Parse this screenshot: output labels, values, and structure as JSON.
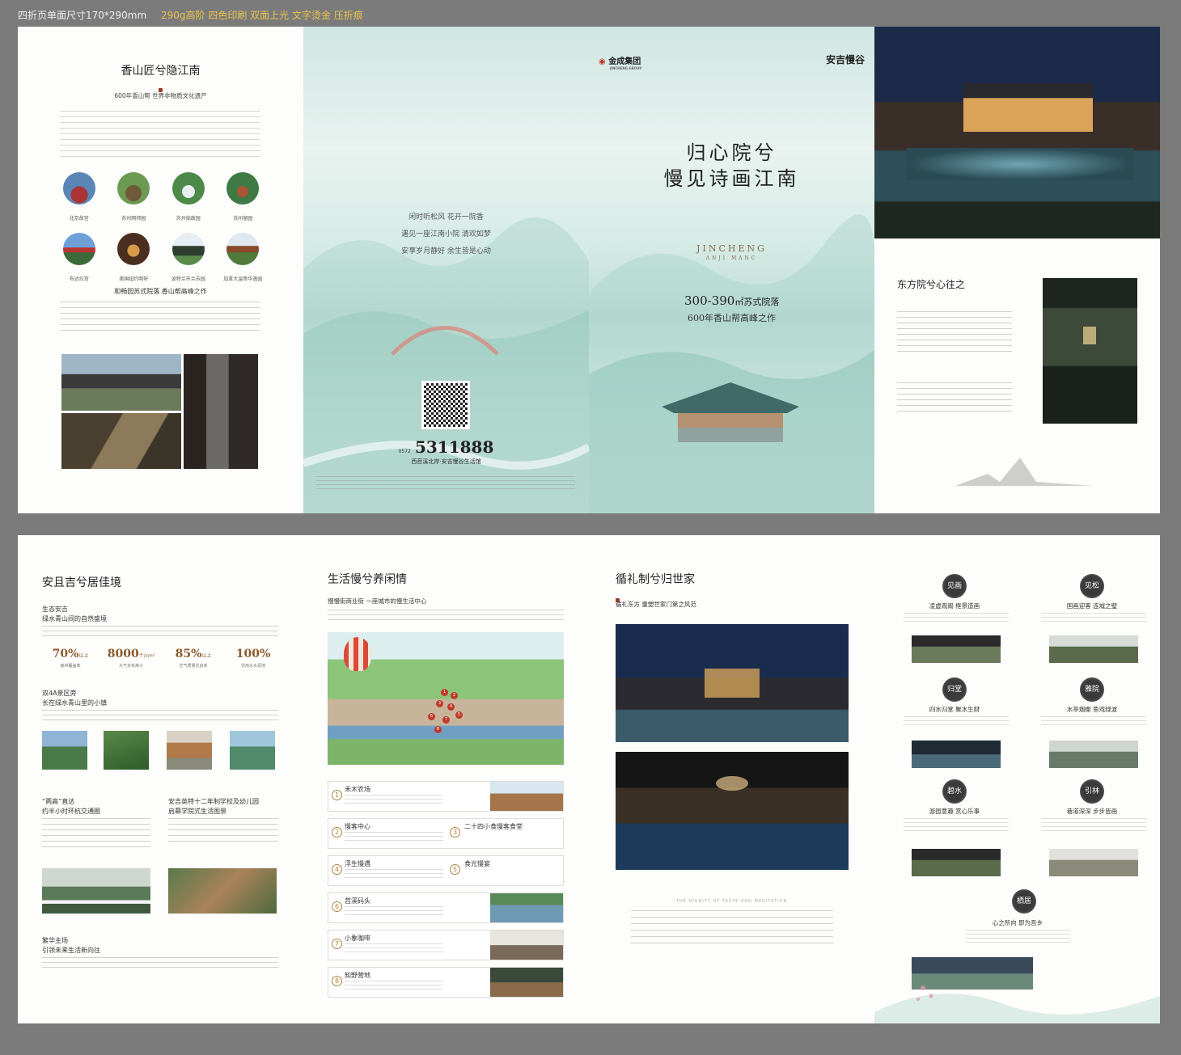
{
  "spec": {
    "text": "四折页单面尺寸170*290mm",
    "gold": "290g高阶 四色印刷 双面上光 文字烫金 压折痕"
  },
  "p1": {
    "title": "香山匠兮隐江南",
    "subtitle": "600年香山帮  世界非物质文化遗产",
    "sites": [
      "北京故宫",
      "苏州网师园",
      "苏州拙政园",
      "苏州留园",
      "布达拉宫",
      "美国纽约明轩",
      "波特兰市兰苏园",
      "加拿大温哥华逸园"
    ],
    "sub2": "和畅园苏式院落  香山帮高峰之作"
  },
  "p2": {
    "poem": [
      "闲时听松风  花开一院香",
      "遇见一座江南小院  清欢如梦",
      "安享岁月静好  余生皆是心动"
    ],
    "tel_prefix": "0572",
    "tel": "5311888",
    "address": "西苕溪北岸·安吉慢谷生活馆"
  },
  "p3": {
    "brand": "金成集团",
    "brand_en": "JINCHENG GROUP",
    "project": "安吉慢谷",
    "headline1": "归心院兮",
    "headline2": "慢见诗画江南",
    "en1": "JINCHENG",
    "en2": "ANJI MANC",
    "area": "300-390",
    "area_unit": "㎡苏式院落",
    "tagline": "600年香山帮高峰之作"
  },
  "p4": {
    "title": "东方院兮心往之"
  },
  "b1": {
    "title": "安且吉兮居佳境",
    "s1a": "生态安吉",
    "s1b": "绿水青山间的自然盛境",
    "stats": [
      {
        "v": "70%",
        "u": "以上",
        "d": "森林覆盖率"
      },
      {
        "v": "8000",
        "u": "个/cm³",
        "d": "大气负氧离子"
      },
      {
        "v": "85%",
        "u": "以上",
        "d": "空气质量优良率"
      },
      {
        "v": "100%",
        "u": "",
        "d": "饮用水水源地"
      }
    ],
    "s2a": "双4A景区旁",
    "s2b": "长在绿水青山里的小镇",
    "s3a": "“两高”直达",
    "s3b": "约半小时环杭交通圈",
    "s4a": "安吉英特十二年制学校及幼儿园",
    "s4b": "启幕学院式生活图景",
    "s5a": "繁华主场",
    "s5b": "引领未来生活新向往"
  },
  "b2": {
    "title": "生活慢兮养闲情",
    "sub": "慢慢街商业街  一座城市的慢生活中心",
    "items": [
      {
        "n": "1",
        "h": "禾木农场",
        "h2": ""
      },
      {
        "n": "2",
        "h": "慢客中心",
        "h2": "二十四小食慢客食堂"
      },
      {
        "n": "4",
        "h": "浮生慢遇",
        "h2": "食光慢宴"
      },
      {
        "n": "6",
        "h": "苕溪码头",
        "h2": ""
      },
      {
        "n": "7",
        "h": "小象咖啡",
        "h2": ""
      },
      {
        "n": "8",
        "h": "知野营地",
        "h2": ""
      }
    ],
    "pins": [
      "1",
      "2",
      "3",
      "4",
      "5",
      "6",
      "7",
      "8"
    ]
  },
  "b3": {
    "title": "循礼制兮归世家",
    "sub": "循礼东方  重塑世家门第之风范",
    "en": "THE DIGNITY OF TASTE AND MEDITATION"
  },
  "b4": {
    "cells": [
      {
        "badge": "见画",
        "h": "凌虚观阁  框景造画"
      },
      {
        "badge": "见松",
        "h": "国画迎客  连城之璧"
      },
      {
        "badge": "归堂",
        "h": "四水归堂  聚水生财"
      },
      {
        "badge": "雅院",
        "h": "水亭烟榭  鱼戏绿波"
      },
      {
        "badge": "碧水",
        "h": "游园意趣  赏心乐事"
      },
      {
        "badge": "引林",
        "h": "巷道深深  步步皆画"
      },
      {
        "badge": "栖居",
        "h": "心之所向  即为吾乡"
      }
    ]
  },
  "colors": {
    "accent": "#8b5a2b",
    "seal": "#9b3b2a",
    "mist": "#cfe6e1"
  }
}
